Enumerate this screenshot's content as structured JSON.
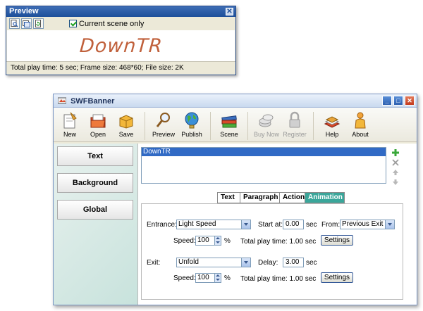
{
  "preview": {
    "title": "Preview",
    "close_glyph": "✕",
    "checkbox_label": "Current scene only",
    "checkbox_checked": true,
    "banner_text": "DownTR",
    "status": "Total play time: 5 sec; Frame size: 468*60; File size: 2K"
  },
  "main": {
    "title": "SWFBanner",
    "toolbar": {
      "new": "New",
      "open": "Open",
      "save": "Save",
      "preview": "Preview",
      "publish": "Publish",
      "scene": "Scene",
      "buy_now": "Buy Now",
      "register": "Register",
      "help": "Help",
      "about": "About"
    },
    "sidebar": {
      "text": "Text",
      "background": "Background",
      "global": "Global"
    },
    "list": {
      "items": [
        "DownTR"
      ]
    },
    "tabs": [
      "Text",
      "Paragraph",
      "Action",
      "Animation"
    ],
    "active_tab": "Animation",
    "animation": {
      "entrance_label": "Entrance:",
      "entrance_value": "Light Speed",
      "start_at_label": "Start at:",
      "start_at_value": "0.00",
      "sec": "sec",
      "from_label": "From:",
      "from_value": "Previous Exit",
      "speed_label": "Speed:",
      "entrance_speed": "100",
      "percent": "%",
      "entrance_total": "Total play time: 1.00 sec",
      "settings": "Settings",
      "exit_label": "Exit:",
      "exit_value": "Unfold",
      "delay_label": "Delay:",
      "delay_value": "3.00",
      "exit_speed": "100",
      "exit_total": "Total play time: 1.00 sec"
    }
  }
}
